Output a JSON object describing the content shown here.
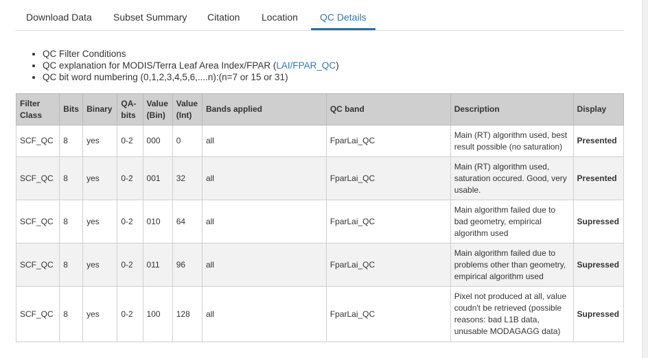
{
  "tabs": [
    {
      "label": "Download Data",
      "active": false
    },
    {
      "label": "Subset Summary",
      "active": false
    },
    {
      "label": "Citation",
      "active": false
    },
    {
      "label": "Location",
      "active": false
    },
    {
      "label": "QC Details",
      "active": true
    }
  ],
  "bullets": {
    "item1": "QC Filter Conditions",
    "item2_prefix": "QC explanation for MODIS/Terra Leaf Area Index/FPAR (",
    "item2_link": "LAI/FPAR_QC",
    "item2_suffix": ")",
    "item3": "QC bit word numbering (0,1,2,3,4,5,6,....n):(n=7 or 15 or 31)"
  },
  "table": {
    "headers": {
      "filter_class": "Filter Class",
      "bits": "Bits",
      "binary": "Binary",
      "qa_bits": "QA-bits",
      "value_bin": "Value (Bin)",
      "value_int": "Value (Int)",
      "bands_applied": "Bands applied",
      "qc_band": "QC band",
      "description": "Description",
      "display": "Display"
    },
    "rows": [
      {
        "filter_class": "SCF_QC",
        "bits": "8",
        "binary": "yes",
        "qa_bits": "0-2",
        "value_bin": "000",
        "value_int": "0",
        "bands_applied": "all",
        "qc_band": "FparLai_QC",
        "description": "Main (RT) algorithm used, best result possible (no saturation)",
        "display": "Presented"
      },
      {
        "filter_class": "SCF_QC",
        "bits": "8",
        "binary": "yes",
        "qa_bits": "0-2",
        "value_bin": "001",
        "value_int": "32",
        "bands_applied": "all",
        "qc_band": "FparLai_QC",
        "description": "Main (RT) algorithm used, saturation occured. Good, very usable.",
        "display": "Presented"
      },
      {
        "filter_class": "SCF_QC",
        "bits": "8",
        "binary": "yes",
        "qa_bits": "0-2",
        "value_bin": "010",
        "value_int": "64",
        "bands_applied": "all",
        "qc_band": "FparLai_QC",
        "description": "Main algorithm failed due to bad geometry, empirical algorithm used",
        "display": "Supressed"
      },
      {
        "filter_class": "SCF_QC",
        "bits": "8",
        "binary": "yes",
        "qa_bits": "0-2",
        "value_bin": "011",
        "value_int": "96",
        "bands_applied": "all",
        "qc_band": "FparLai_QC",
        "description": "Main algorithm failed due to problems other than geometry, empirical algorithm used",
        "display": "Supressed"
      },
      {
        "filter_class": "SCF_QC",
        "bits": "8",
        "binary": "yes",
        "qa_bits": "0-2",
        "value_bin": "100",
        "value_int": "128",
        "bands_applied": "all",
        "qc_band": "FparLai_QC",
        "description": "Pixel not produced at all, value coudn't be retrieved (possible reasons: bad L1B data, unusable MODAGAGG data)",
        "display": "Supressed"
      }
    ]
  }
}
